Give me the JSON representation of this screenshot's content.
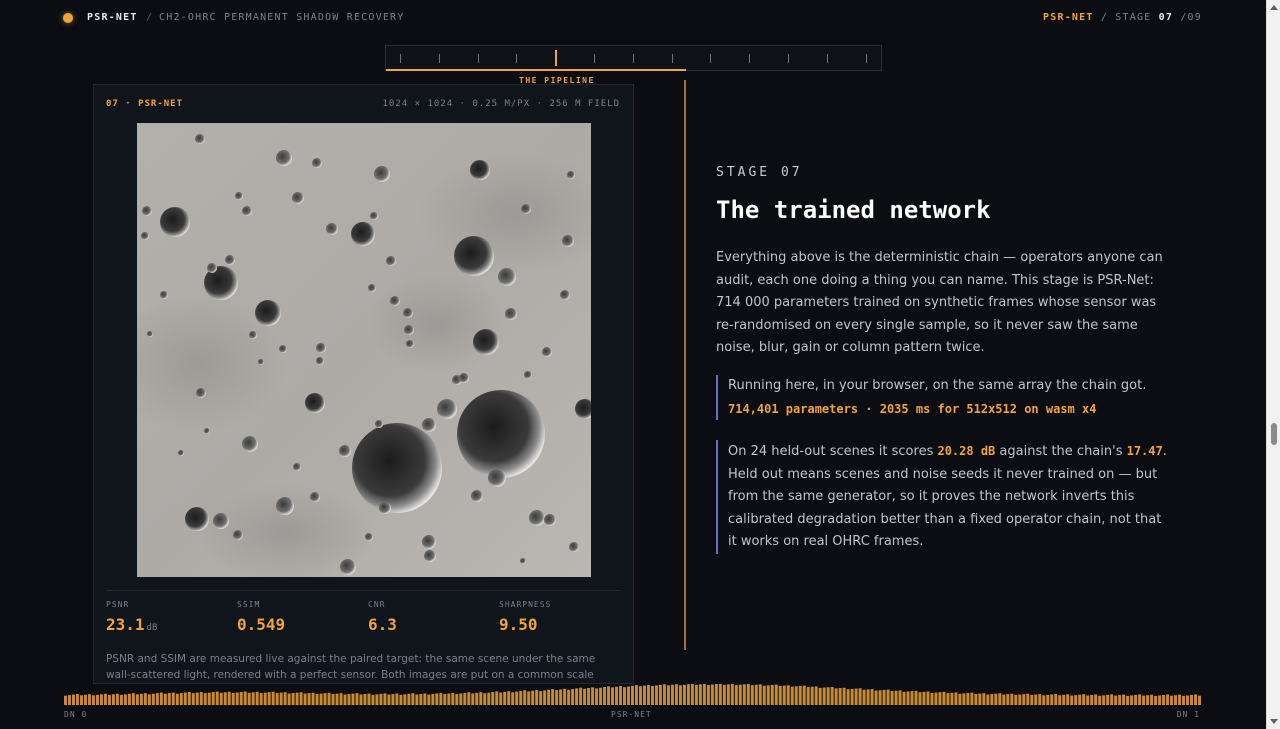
{
  "header": {
    "brand": "PSR-NET",
    "separator": "/",
    "subtitle": "CH2-OHRC PERMANENT SHADOW RECOVERY",
    "stage_brand": "PSR-NET",
    "stage_prefix": "STAGE",
    "stage_current": "07",
    "stage_total": "/09"
  },
  "pipeline": {
    "label": "THE PIPELINE",
    "tick_count": 13,
    "active_index": 4
  },
  "card": {
    "tag": "07 · PSR-NET",
    "meta": "1024 × 1024 · 0.25 M/PX · 256 M FIELD",
    "image_icon": "lunar-surface-image",
    "metrics": [
      {
        "label": "PSNR",
        "value": "23.1",
        "unit": "dB"
      },
      {
        "label": "SSIM",
        "value": "0.549",
        "unit": ""
      },
      {
        "label": "CNR",
        "value": "6.3",
        "unit": ""
      },
      {
        "label": "SHARPNESS",
        "value": "9.50",
        "unit": ""
      }
    ],
    "note": "PSNR and SSIM are measured live against the paired target: the same scene under the same wall-scattered light, rendered with a perfect sensor. Both images are put on a common scale by a least-"
  },
  "content": {
    "stage_label": "STAGE 07",
    "title": "The trained network",
    "lede": "Everything above is the deterministic chain — operators anyone can audit, each one doing a thing you can name. This stage is PSR-Net: 714 000 parameters trained on synthetic frames whose sensor was re-randomised on every single sample, so it never saw the same noise, blur, gain or column pattern twice.",
    "quote1_text": "Running here, in your browser, on the same array the chain got.",
    "quote1_highlight": "714,401 parameters · 2035 ms for 512x512 on wasm x4",
    "quote2_a": "On 24 held-out scenes it scores ",
    "quote2_score": "20.28 dB",
    "quote2_b": " against the chain's ",
    "quote2_chain": "17.47",
    "quote2_c": ". Held out means scenes and noise seeds it never trained on — but from the same generator, so it proves the network inverts this calibrated degradation better than a fixed operator chain, not that it works on real OHRC frames."
  },
  "histogram": {
    "left_label": "DN 0",
    "center_label": "PSR-NET",
    "right_label": "DN 1",
    "bar_color": "#c98a34"
  },
  "colors": {
    "accent": "#f0a43c",
    "quote_border": "#6770c9",
    "background": "#0b0d12"
  }
}
